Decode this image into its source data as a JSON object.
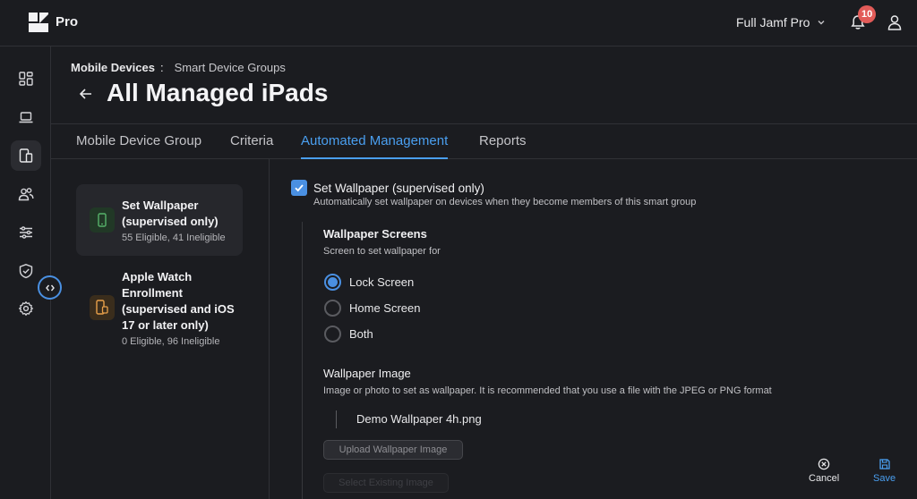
{
  "app": {
    "brand": "Pro"
  },
  "topbar": {
    "environment": "Full Jamf Pro",
    "notification_count": "10",
    "accent_color": "#4a90e2",
    "badge_color": "#e25b58"
  },
  "sidebar": {
    "items": [
      {
        "icon": "dashboard-icon"
      },
      {
        "icon": "computer-icon"
      },
      {
        "icon": "mobile-devices-icon",
        "active": true
      },
      {
        "icon": "users-icon"
      },
      {
        "icon": "settings-sliders-icon"
      },
      {
        "icon": "shield-icon"
      },
      {
        "icon": "gear-icon"
      }
    ],
    "collapse_icon": "code-brackets-icon"
  },
  "breadcrumb": {
    "parent": "Mobile Devices",
    "separator": ":",
    "current": "Smart Device Groups"
  },
  "page": {
    "title": "All Managed iPads"
  },
  "tabs": [
    {
      "label": "Mobile Device Group"
    },
    {
      "label": "Criteria"
    },
    {
      "label": "Automated Management",
      "active": true
    },
    {
      "label": "Reports"
    }
  ],
  "actions": [
    {
      "title": "Set Wallpaper (supervised only)",
      "stats": "55 Eligible, 41 Ineligible",
      "icon": "phone-icon",
      "icon_color": "#57b26a",
      "active": true
    },
    {
      "title": "Apple Watch Enrollment (supervised and iOS 17 or later only)",
      "stats": "0 Eligible, 96 Ineligible",
      "icon": "phone-watch-icon",
      "icon_color": "#e8a04a"
    }
  ],
  "detail": {
    "enable_label": "Set Wallpaper (supervised only)",
    "enable_checked": true,
    "enable_description": "Automatically set wallpaper on devices when they become members of this smart group",
    "screens": {
      "title": "Wallpaper Screens",
      "description": "Screen to set wallpaper for",
      "options": [
        {
          "label": "Lock Screen",
          "checked": true
        },
        {
          "label": "Home Screen",
          "checked": false
        },
        {
          "label": "Both",
          "checked": false
        }
      ]
    },
    "image": {
      "title": "Wallpaper Image",
      "description": "Image or photo to set as wallpaper. It is recommended that you use a file with the JPEG or PNG format",
      "file_name": "Demo Wallpaper 4h.png",
      "upload_label": "Upload Wallpaper Image",
      "select_label": "Select Existing Image"
    }
  },
  "footer": {
    "cancel_label": "Cancel",
    "save_label": "Save"
  }
}
